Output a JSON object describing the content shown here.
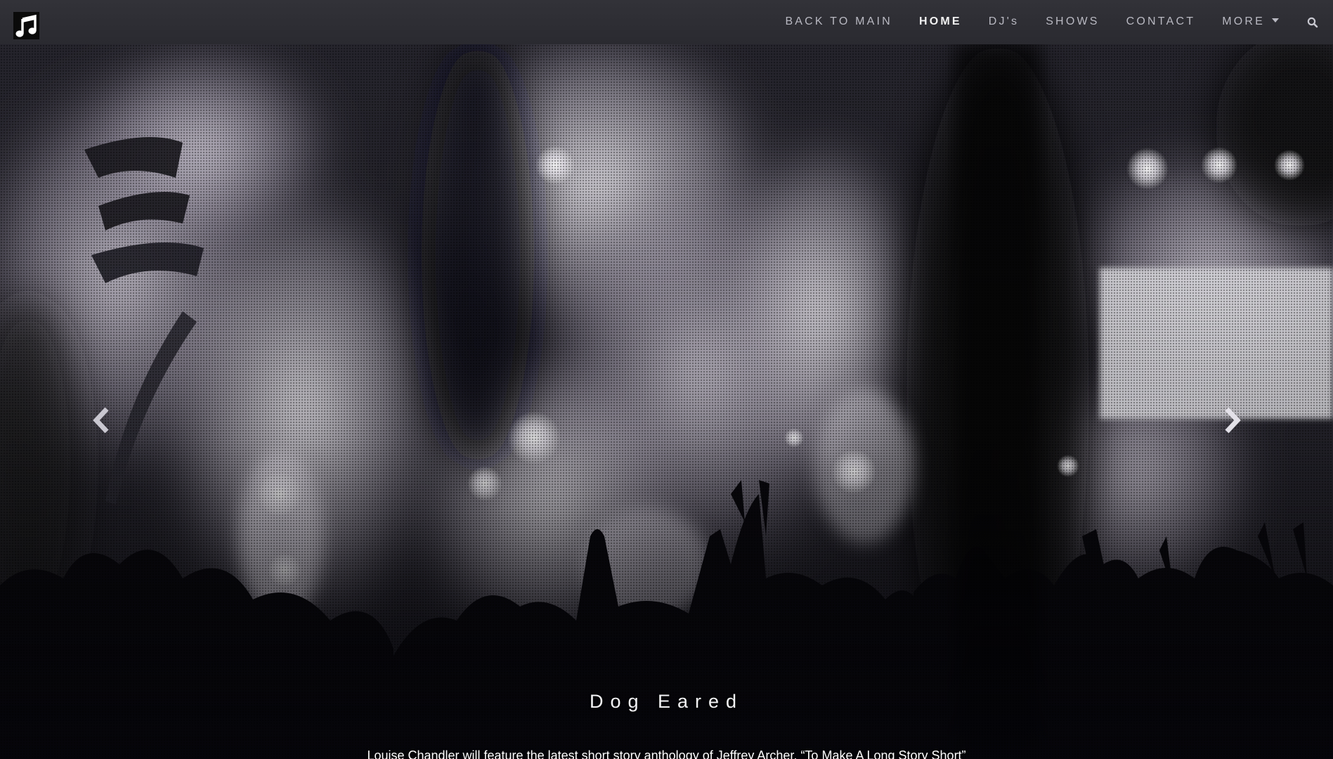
{
  "nav": {
    "items": [
      {
        "label": "BACK TO MAIN",
        "active": false
      },
      {
        "label": "HOME",
        "active": true
      },
      {
        "label": "DJ's",
        "active": false
      },
      {
        "label": "SHOWS",
        "active": false
      },
      {
        "label": "CONTACT",
        "active": false
      },
      {
        "label": "MORE",
        "active": false
      }
    ],
    "logo_icon": "music-note-icon",
    "search_icon": "search-icon",
    "more_icon": "caret-down-icon"
  },
  "carousel": {
    "prev_icon": "chevron-left-icon",
    "next_icon": "chevron-right-icon",
    "slide": {
      "title": "Dog Eared",
      "text": "Louise Chandler will feature the latest short story anthology of Jeffrey Archer, “To Make A Long Story Short”"
    }
  },
  "colors": {
    "navbar": "#2e2e34",
    "nav_text": "#b9b9c2",
    "nav_active": "#f2f2f2",
    "hero_dark": "#141419"
  }
}
